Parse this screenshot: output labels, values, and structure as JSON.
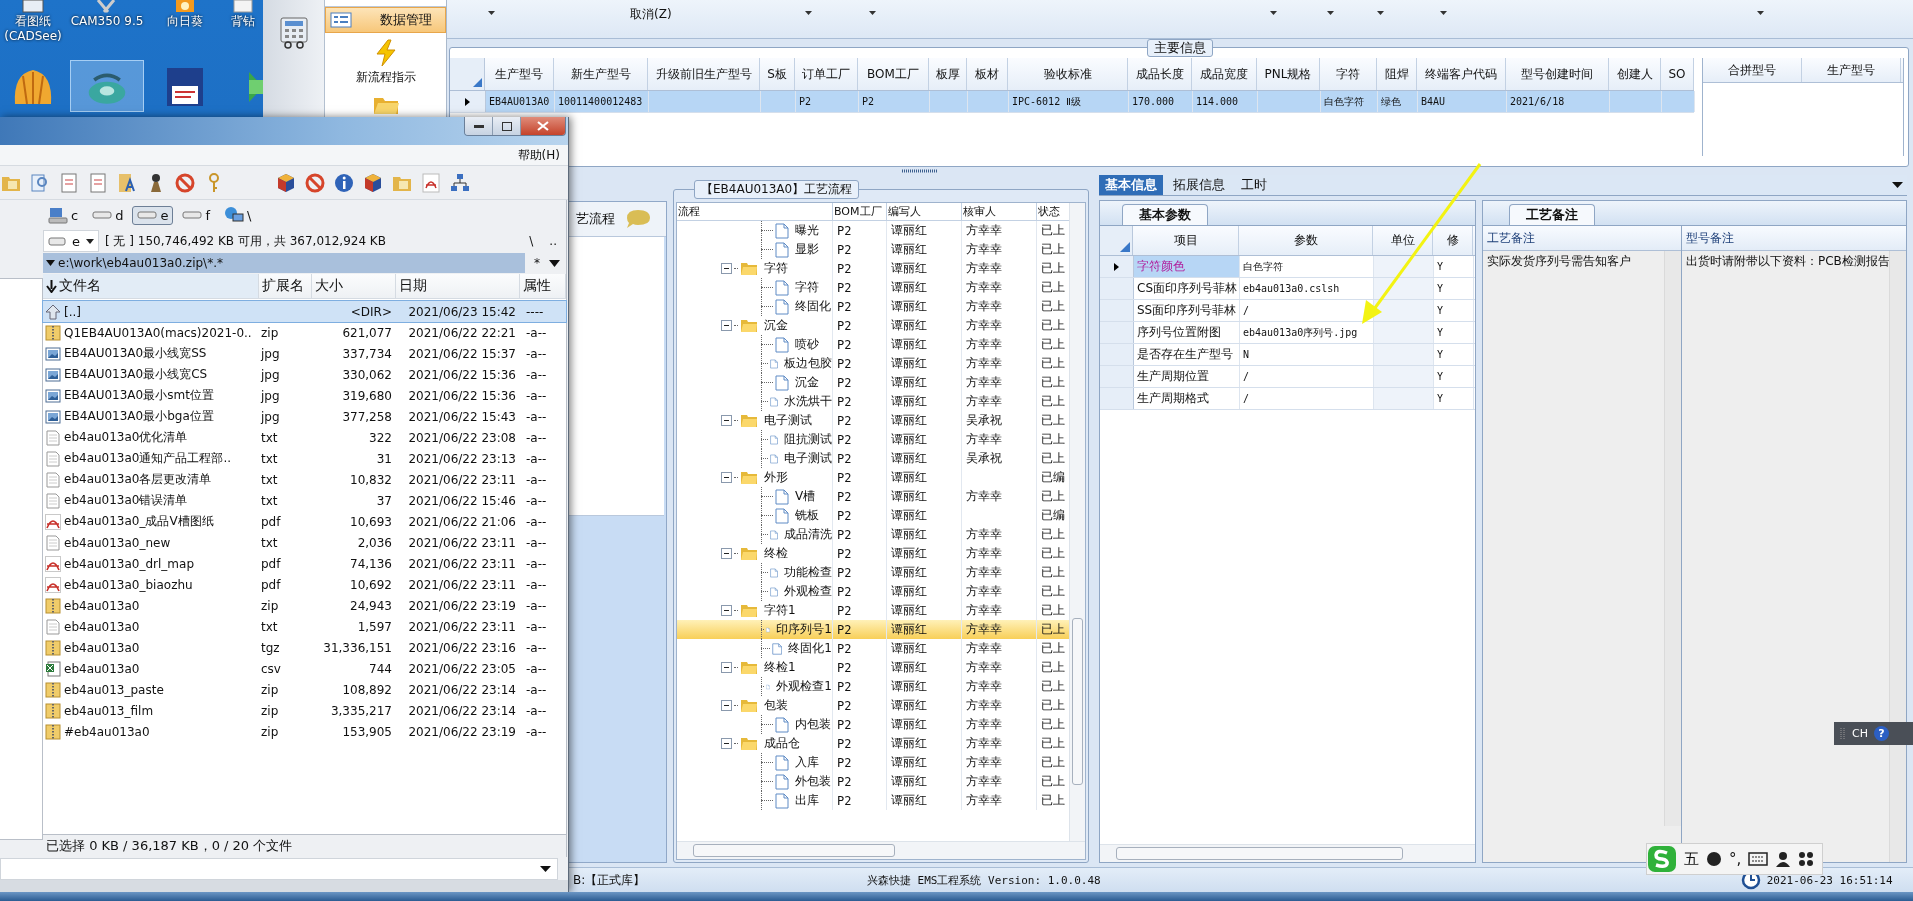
{
  "desktop": {
    "icons": [
      {
        "kind": "viewer",
        "label_lines": [
          "看图纸",
          "(CADSee)"
        ],
        "selected": false
      },
      {
        "kind": "cam",
        "label_lines": [
          "CAM350 9.5"
        ],
        "selected": false
      },
      {
        "kind": "sunflower",
        "label_lines": [
          "向日葵"
        ],
        "selected": false
      },
      {
        "kind": "drill",
        "label_lines": [
          "背钻"
        ],
        "selected": false
      },
      {
        "kind": "shell",
        "selected": false
      },
      {
        "kind": "disc",
        "selected": true
      },
      {
        "kind": "floppy",
        "selected": false
      },
      {
        "kind": "arrow",
        "selected": false
      }
    ]
  },
  "app": {
    "nav": [
      {
        "kind": "form",
        "label": "数据管理",
        "selected": true
      },
      {
        "kind": "bolt",
        "label": "新流程指示",
        "selected": false
      },
      {
        "kind": "folder",
        "selected": false
      }
    ],
    "toolbar": {
      "cancel_label": "取消(Z)"
    },
    "main_info": {
      "title": "主要信息",
      "columns": [
        "生产型号",
        "新生产型号",
        "升级前旧生产型号",
        "S板",
        "订单工厂",
        "BOM工厂",
        "板厚",
        "板材",
        "验收标准",
        "成品长度",
        "成品宽度",
        "PNL规格",
        "字符",
        "阻焊",
        "终端客户代码",
        "型号创建时间",
        "创建人",
        "SO"
      ],
      "rows": [
        {
          "selected": true,
          "cells": [
            "EB4AU013A0",
            "10011400012483",
            null,
            null,
            "P2",
            "P2",
            null,
            null,
            "IPC-6012 Ⅱ级",
            "170.000",
            "114.000",
            null,
            "白色字符",
            "绿色",
            "B4AU",
            "2021/6/18",
            null,
            null
          ]
        }
      ],
      "merge_columns": [
        "合拼型号",
        "生产型号"
      ]
    },
    "process_panel": {
      "title": "艺流程"
    },
    "flow": {
      "title": "【EB4AU013A0】工艺流程",
      "columns": [
        "流程",
        "BOM工厂",
        "编写人",
        "核审人",
        "状态"
      ],
      "continued": [
        {
          "name": "曝光",
          "bom": "P2",
          "writer": "谭丽红",
          "reviewer": "方幸幸",
          "status": "已上",
          "selected": false
        },
        {
          "name": "显影",
          "bom": "P2",
          "writer": "谭丽红",
          "reviewer": "方幸幸",
          "status": "已上",
          "selected": false
        }
      ],
      "groups": [
        {
          "name": "字符",
          "bom": "P2",
          "writer": "谭丽红",
          "reviewer": "方幸幸",
          "status": "已上",
          "expanded": true,
          "selected": false,
          "children": [
            {
              "name": "字符",
              "bom": "P2",
              "writer": "谭丽红",
              "reviewer": "方幸幸",
              "status": "已上",
              "selected": false
            },
            {
              "name": "终固化",
              "bom": "P2",
              "writer": "谭丽红",
              "reviewer": "方幸幸",
              "status": "已上",
              "selected": false
            }
          ]
        },
        {
          "name": "沉金",
          "bom": "P2",
          "writer": "谭丽红",
          "reviewer": "方幸幸",
          "status": "已上",
          "expanded": true,
          "selected": false,
          "children": [
            {
              "name": "喷砂",
              "bom": "P2",
              "writer": "谭丽红",
              "reviewer": "方幸幸",
              "status": "已上",
              "selected": false
            },
            {
              "name": "板边包胶",
              "bom": "P2",
              "writer": "谭丽红",
              "reviewer": "方幸幸",
              "status": "已上",
              "selected": false
            },
            {
              "name": "沉金",
              "bom": "P2",
              "writer": "谭丽红",
              "reviewer": "方幸幸",
              "status": "已上",
              "selected": false
            },
            {
              "name": "水洗烘干",
              "bom": "P2",
              "writer": "谭丽红",
              "reviewer": "方幸幸",
              "status": "已上",
              "selected": false
            }
          ]
        },
        {
          "name": "电子测试",
          "bom": "P2",
          "writer": "谭丽红",
          "reviewer": "吴承祝",
          "status": "已上",
          "expanded": true,
          "selected": false,
          "children": [
            {
              "name": "阻抗测试",
              "bom": "P2",
              "writer": "谭丽红",
              "reviewer": "方幸幸",
              "status": "已上",
              "selected": false
            },
            {
              "name": "电子测试",
              "bom": "P2",
              "writer": "谭丽红",
              "reviewer": "吴承祝",
              "status": "已上",
              "selected": false
            }
          ]
        },
        {
          "name": "外形",
          "bom": "P2",
          "writer": "谭丽红",
          "status": "已编",
          "expanded": true,
          "selected": false,
          "children": [
            {
              "name": "V槽",
              "bom": "P2",
              "writer": "谭丽红",
              "reviewer": "方幸幸",
              "status": "已上",
              "selected": false
            },
            {
              "name": "铣板",
              "bom": "P2",
              "writer": "谭丽红",
              "status": "已编",
              "selected": false
            },
            {
              "name": "成品清洗",
              "bom": "P2",
              "writer": "谭丽红",
              "reviewer": "方幸幸",
              "status": "已上",
              "selected": false
            }
          ]
        },
        {
          "name": "终检",
          "bom": "P2",
          "writer": "谭丽红",
          "reviewer": "方幸幸",
          "status": "已上",
          "expanded": true,
          "selected": false,
          "children": [
            {
              "name": "功能检查",
              "bom": "P2",
              "writer": "谭丽红",
              "reviewer": "方幸幸",
              "status": "已上",
              "selected": false
            },
            {
              "name": "外观检查",
              "bom": "P2",
              "writer": "谭丽红",
              "reviewer": "方幸幸",
              "status": "已上",
              "selected": false
            }
          ]
        },
        {
          "name": "字符1",
          "bom": "P2",
          "writer": "谭丽红",
          "reviewer": "方幸幸",
          "status": "已上",
          "expanded": true,
          "selected": false,
          "children": [
            {
              "name": "印序列号1",
              "bom": "P2",
              "writer": "谭丽红",
              "reviewer": "方幸幸",
              "status": "已上",
              "selected": true
            },
            {
              "name": "终固化1",
              "bom": "P2",
              "writer": "谭丽红",
              "reviewer": "方幸幸",
              "status": "已上",
              "selected": false
            }
          ]
        },
        {
          "name": "终检1",
          "bom": "P2",
          "writer": "谭丽红",
          "reviewer": "方幸幸",
          "status": "已上",
          "expanded": true,
          "selected": false,
          "children": [
            {
              "name": "外观检查1",
              "bom": "P2",
              "writer": "谭丽红",
              "reviewer": "方幸幸",
              "status": "已上",
              "selected": false
            }
          ]
        },
        {
          "name": "包装",
          "bom": "P2",
          "writer": "谭丽红",
          "reviewer": "方幸幸",
          "status": "已上",
          "expanded": true,
          "selected": false,
          "children": [
            {
              "name": "内包装",
              "bom": "P2",
              "writer": "谭丽红",
              "reviewer": "方幸幸",
              "status": "已上",
              "selected": false
            }
          ]
        },
        {
          "name": "成品仓",
          "bom": "P2",
          "writer": "谭丽红",
          "reviewer": "方幸幸",
          "status": "已上",
          "expanded": true,
          "selected": false,
          "children": [
            {
              "name": "入库",
              "bom": "P2",
              "writer": "谭丽红",
              "reviewer": "方幸幸",
              "status": "已上",
              "selected": false
            },
            {
              "name": "外包装",
              "bom": "P2",
              "writer": "谭丽红",
              "reviewer": "方幸幸",
              "status": "已上",
              "selected": false
            },
            {
              "name": "出库",
              "bom": "P2",
              "writer": "谭丽红",
              "reviewer": "方幸幸",
              "status": "已上",
              "selected": false
            }
          ]
        }
      ]
    },
    "detail": {
      "tabs": [
        {
          "label": "基本信息",
          "selected": true
        },
        {
          "label": "拓展信息",
          "selected": false
        },
        {
          "label": "工时",
          "selected": false
        }
      ],
      "subtab": "基本参数",
      "columns": [
        "项目",
        "参数",
        "单位",
        "修"
      ],
      "rows": [
        {
          "item": "字符颜色",
          "value": "白色字符",
          "modified": "Y",
          "selected": true
        },
        {
          "item": "CS面印序列号菲林",
          "value": "eb4au013a0.cslsh",
          "modified": "Y",
          "selected": false
        },
        {
          "item": "SS面印序列号菲林",
          "value": "/",
          "modified": "Y",
          "selected": false
        },
        {
          "item": "序列号位置附图",
          "value": "eb4au013a0序列号.jpg",
          "modified": "Y",
          "selected": false
        },
        {
          "item": "是否存在生产型号",
          "value": "N",
          "modified": "Y",
          "selected": false
        },
        {
          "item": "生产周期位置",
          "value": "/",
          "modified": "Y",
          "selected": false
        },
        {
          "item": "生产周期格式",
          "value": "/",
          "modified": "Y",
          "selected": false
        }
      ],
      "notes_tab": "工艺备注",
      "notes_columns": [
        "工艺备注",
        "型号备注"
      ],
      "notes": [
        "实际发货序列号需告知客户",
        "出货时请附带以下资料：PCB检测报告"
      ]
    },
    "status_bar": {
      "db": "B:【正式库】",
      "product": "兴森快捷 EMS工程系统 Version: 1.0.0.48",
      "clock": "2021-06-23 16:51:14"
    }
  },
  "file_manager": {
    "menu": [
      "帮助(H)"
    ],
    "drives": [
      {
        "label": "c",
        "kind": "system",
        "selected": false
      },
      {
        "label": "d",
        "kind": "disk",
        "selected": false
      },
      {
        "label": "e",
        "kind": "disk",
        "selected": true
      },
      {
        "label": "f",
        "kind": "disk",
        "selected": false
      },
      {
        "label": "\\",
        "kind": "network",
        "selected": false
      }
    ],
    "drive_combo": "e",
    "free_space": "[ 无 ] 150,746,492 KB 可用，共 367,012,924 KB",
    "root_button": "\\",
    "up_button": "..",
    "path": "e:\\work\\eb4au013a0.zip\\*.*",
    "filter": "*",
    "columns": [
      "文件名",
      "扩展名",
      "大小",
      "日期",
      "属性"
    ],
    "files": [
      {
        "kind": "up",
        "name": "[..]",
        "size": "<DIR>",
        "date": "2021/06/23 15:42",
        "attr": "----",
        "selected": true
      },
      {
        "kind": "zip",
        "name": "Q1EB4AU013A0(macs)2021-0..",
        "ext": "zip",
        "size": "621,077",
        "date": "2021/06/22 22:21",
        "attr": "-a--",
        "selected": false
      },
      {
        "kind": "jpg",
        "name": "EB4AU013A0最小线宽SS",
        "ext": "jpg",
        "size": "337,734",
        "date": "2021/06/22 15:37",
        "attr": "-a--",
        "selected": false
      },
      {
        "kind": "jpg",
        "name": "EB4AU013A0最小线宽CS",
        "ext": "jpg",
        "size": "330,062",
        "date": "2021/06/22 15:36",
        "attr": "-a--",
        "selected": false
      },
      {
        "kind": "jpg",
        "name": "EB4AU013A0最小smt位置",
        "ext": "jpg",
        "size": "319,680",
        "date": "2021/06/22 15:36",
        "attr": "-a--",
        "selected": false
      },
      {
        "kind": "jpg",
        "name": "EB4AU013A0最小bga位置",
        "ext": "jpg",
        "size": "377,258",
        "date": "2021/06/22 15:43",
        "attr": "-a--",
        "selected": false
      },
      {
        "kind": "txt",
        "name": "eb4au013a0优化清单",
        "ext": "txt",
        "size": "322",
        "date": "2021/06/22 23:08",
        "attr": "-a--",
        "selected": false
      },
      {
        "kind": "txt",
        "name": "eb4au013a0通知产品工程部..",
        "ext": "txt",
        "size": "31",
        "date": "2021/06/22 23:13",
        "attr": "-a--",
        "selected": false
      },
      {
        "kind": "txt",
        "name": "eb4au013a0各层更改清单",
        "ext": "txt",
        "size": "10,832",
        "date": "2021/06/22 23:11",
        "attr": "-a--",
        "selected": false
      },
      {
        "kind": "txt",
        "name": "eb4au013a0错误清单",
        "ext": "txt",
        "size": "37",
        "date": "2021/06/22 15:46",
        "attr": "-a--",
        "selected": false
      },
      {
        "kind": "pdf",
        "name": "eb4au013a0_成品V槽图纸",
        "ext": "pdf",
        "size": "10,693",
        "date": "2021/06/22 21:06",
        "attr": "-a--",
        "selected": false
      },
      {
        "kind": "txt",
        "name": "eb4au013a0_new",
        "ext": "txt",
        "size": "2,036",
        "date": "2021/06/22 23:11",
        "attr": "-a--",
        "selected": false
      },
      {
        "kind": "pdf",
        "name": "eb4au013a0_drl_map",
        "ext": "pdf",
        "size": "74,136",
        "date": "2021/06/22 23:11",
        "attr": "-a--",
        "selected": false
      },
      {
        "kind": "pdf",
        "name": "eb4au013a0_biaozhu",
        "ext": "pdf",
        "size": "10,692",
        "date": "2021/06/22 23:11",
        "attr": "-a--",
        "selected": false
      },
      {
        "kind": "zip",
        "name": "eb4au013a0",
        "ext": "zip",
        "size": "24,943",
        "date": "2021/06/22 23:19",
        "attr": "-a--",
        "selected": false
      },
      {
        "kind": "txt",
        "name": "eb4au013a0",
        "ext": "txt",
        "size": "1,597",
        "date": "2021/06/22 23:11",
        "attr": "-a--",
        "selected": false
      },
      {
        "kind": "zip",
        "name": "eb4au013a0",
        "ext": "tgz",
        "size": "31,336,151",
        "date": "2021/06/22 23:16",
        "attr": "-a--",
        "selected": false
      },
      {
        "kind": "csv",
        "name": "eb4au013a0",
        "ext": "csv",
        "size": "744",
        "date": "2021/06/22 23:05",
        "attr": "-a--",
        "selected": false
      },
      {
        "kind": "zip",
        "name": "eb4au013_paste",
        "ext": "zip",
        "size": "108,892",
        "date": "2021/06/22 23:14",
        "attr": "-a--",
        "selected": false
      },
      {
        "kind": "zip",
        "name": "eb4au013_film",
        "ext": "zip",
        "size": "3,335,217",
        "date": "2021/06/22 23:14",
        "attr": "-a--",
        "selected": false
      },
      {
        "kind": "zip",
        "name": "#eb4au013a0",
        "ext": "zip",
        "size": "153,905",
        "date": "2021/06/22 23:19",
        "attr": "-a--",
        "selected": false
      }
    ],
    "status": "已选择 0 KB / 36,187 KB，0 / 20 个文件"
  },
  "ime_bar": {
    "mode": "五",
    "punct": "°,"
  },
  "language_bar": {
    "label": "CH",
    "help": "?"
  }
}
